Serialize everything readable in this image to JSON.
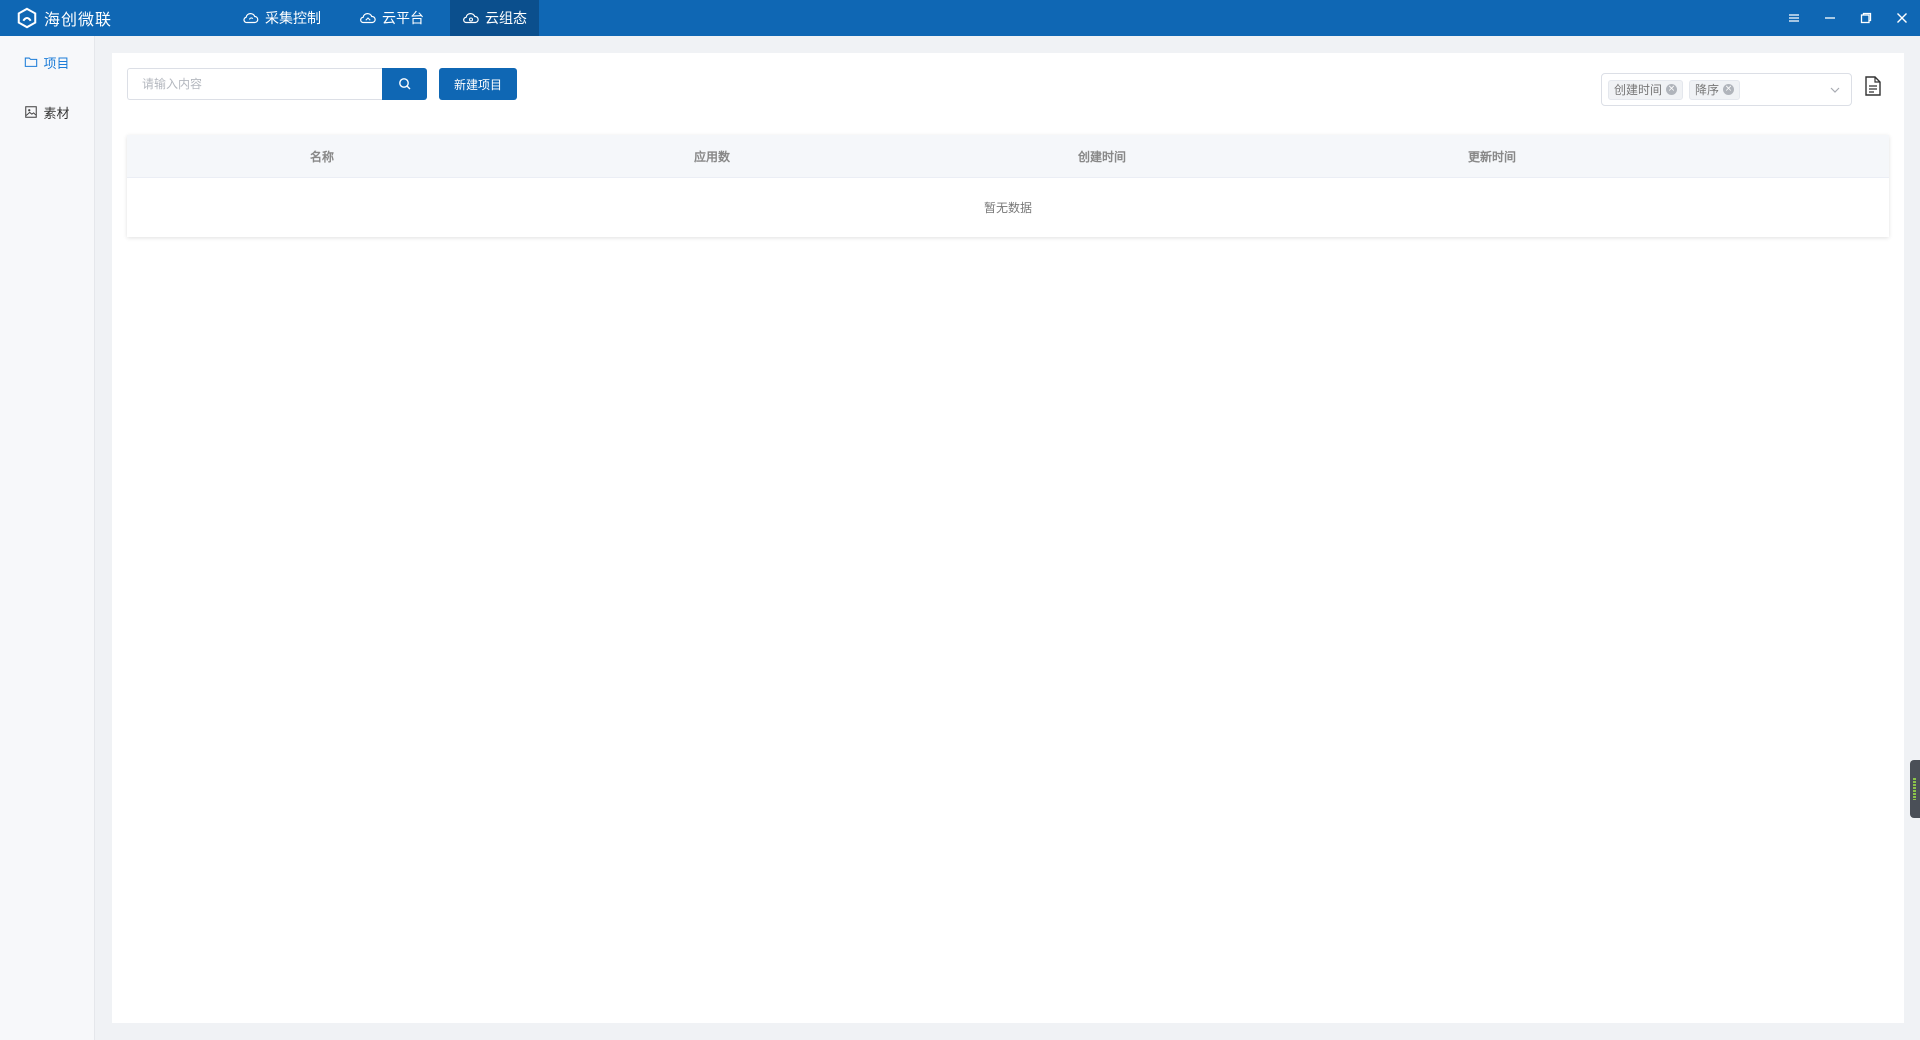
{
  "app": {
    "name": "海创微联",
    "nav_tabs": [
      {
        "label": "采集控制",
        "icon": "cloud-refresh-icon"
      },
      {
        "label": "云平台",
        "icon": "cloud-house-icon"
      },
      {
        "label": "云组态",
        "icon": "cloud-config-icon",
        "active": true
      }
    ],
    "window_controls": [
      "menu-icon",
      "minimize-icon",
      "restore-icon",
      "close-icon"
    ]
  },
  "sidebar": {
    "items": [
      {
        "label": "项目",
        "icon": "folder-icon",
        "active": true
      },
      {
        "label": "素材",
        "icon": "image-icon"
      }
    ]
  },
  "toolbar": {
    "search_placeholder": "请输入内容",
    "search_value": "",
    "new_button": "新建项目"
  },
  "sort": {
    "tags": [
      "创建时间",
      "降序"
    ]
  },
  "table": {
    "columns": [
      "名称",
      "应用数",
      "创建时间",
      "更新时间"
    ],
    "rows": [],
    "empty_text": "暂无数据"
  },
  "colors": {
    "primary": "#0f67b4",
    "active_tab": "#0b4f8d",
    "sidebar_active": "#1d7dd8"
  }
}
